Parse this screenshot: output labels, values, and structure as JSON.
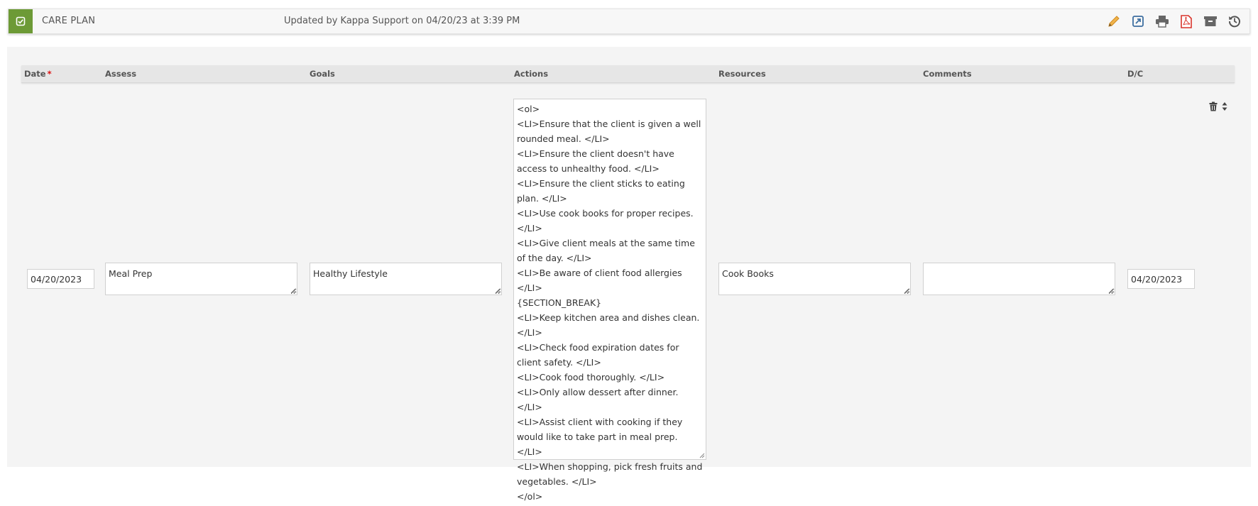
{
  "header": {
    "title": "CARE PLAN",
    "updated_text": "Updated by Kappa Support on 04/20/23 at 3:39 PM",
    "icons": [
      "check-icon",
      "edit-icon",
      "export-icon",
      "print-icon",
      "pdf-icon",
      "archive-icon",
      "history-icon"
    ]
  },
  "columns": {
    "date": "Date",
    "date_required": "*",
    "assess": "Assess",
    "goals": "Goals",
    "actions": "Actions",
    "resources": "Resources",
    "comments": "Comments",
    "dc": "D/C"
  },
  "row": {
    "date": "04/20/2023",
    "assess": "Meal Prep",
    "goals": "Healthy Lifestyle",
    "actions": "<ol>\n<LI>Ensure that the client is given a well rounded meal. </LI>\n<LI>Ensure the client doesn't have access to unhealthy food. </LI>\n<LI>Ensure the client sticks to eating plan. </LI>\n<LI>Use cook books for proper recipes. </LI>\n<LI>Give client meals at the same time of the day. </LI>\n<LI>Be aware of client food allergies </LI>\n{SECTION_BREAK}\n<LI>Keep kitchen area and dishes clean. </LI>\n<LI>Check food expiration dates for client safety. </LI>\n<LI>Cook food thoroughly. </LI>\n<LI>Only allow dessert after dinner. </LI>\n<LI>Assist client with cooking if they would like to take part in meal prep. </LI>\n<LI>When shopping, pick fresh fruits and vegetables. </LI>\n</ol>",
    "resources": "Cook Books",
    "comments": "",
    "dc_date": "04/20/2023"
  },
  "colors": {
    "accent_green": "#6d9a36",
    "edit_orange": "#e8a13a",
    "pdf_red": "#d9342b",
    "required_red": "#dd1111"
  }
}
